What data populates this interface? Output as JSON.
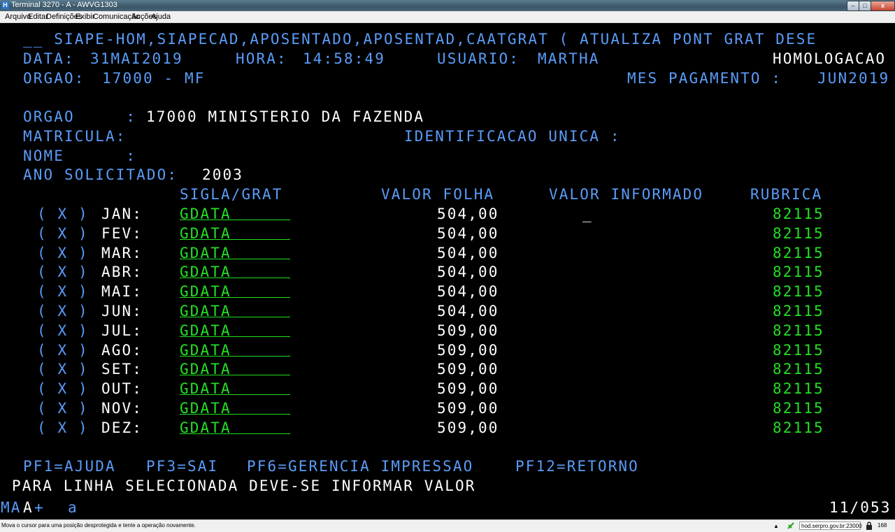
{
  "window": {
    "title": "Terminal 3270 - A - AWVG1303",
    "close": "x",
    "min": "–",
    "max": "□",
    "app_icon": "H"
  },
  "menu": [
    "Arquivo",
    "Editar",
    "Definições",
    "Exibir",
    "Comunicação",
    "Acções",
    "Ajuda"
  ],
  "header": {
    "line1": "__ SIAPE-HOM,SIAPECAD,APOSENTADO,APOSENTAD,CAATGRAT ( ATUALIZA PONT GRAT DESE",
    "data_label": "DATA:",
    "data_value": "31MAI2019",
    "hora_label": "HORA:",
    "hora_value": "14:58:49",
    "usuario_label": "USUARIO:",
    "usuario_value": "MARTHA",
    "env": "HOMOLOGACAO",
    "orgao_label": "ORGAO:",
    "orgao_value": "17000 - MF",
    "mes_label": "MES PAGAMENTO :",
    "mes_value": "JUN2019"
  },
  "form": {
    "orgao_label": "ORGAO     :",
    "orgao_value": "17000 MINISTERIO DA FAZENDA",
    "matricula_label": "MATRICULA:",
    "ident_label": "IDENTIFICACAO UNICA :",
    "nome_label": "NOME      :",
    "ano_label": "ANO SOLICITADO:",
    "ano_value": "2003"
  },
  "table": {
    "headers": {
      "sigla": "SIGLA/GRAT",
      "valor_folha": "VALOR FOLHA",
      "valor_informado": "VALOR INFORMADO",
      "rubrica": "RUBRICA"
    },
    "rows": [
      {
        "sel": "( X )",
        "mes": "JAN:",
        "sigla": "GDATA",
        "valor": "504,00",
        "informado": "_",
        "rubrica": "82115"
      },
      {
        "sel": "( X )",
        "mes": "FEV:",
        "sigla": "GDATA",
        "valor": "504,00",
        "informado": "",
        "rubrica": "82115"
      },
      {
        "sel": "( X )",
        "mes": "MAR:",
        "sigla": "GDATA",
        "valor": "504,00",
        "informado": "",
        "rubrica": "82115"
      },
      {
        "sel": "( X )",
        "mes": "ABR:",
        "sigla": "GDATA",
        "valor": "504,00",
        "informado": "",
        "rubrica": "82115"
      },
      {
        "sel": "( X )",
        "mes": "MAI:",
        "sigla": "GDATA",
        "valor": "504,00",
        "informado": "",
        "rubrica": "82115"
      },
      {
        "sel": "( X )",
        "mes": "JUN:",
        "sigla": "GDATA",
        "valor": "504,00",
        "informado": "",
        "rubrica": "82115"
      },
      {
        "sel": "( X )",
        "mes": "JUL:",
        "sigla": "GDATA",
        "valor": "509,00",
        "informado": "",
        "rubrica": "82115"
      },
      {
        "sel": "( X )",
        "mes": "AGO:",
        "sigla": "GDATA",
        "valor": "509,00",
        "informado": "",
        "rubrica": "82115"
      },
      {
        "sel": "( X )",
        "mes": "SET:",
        "sigla": "GDATA",
        "valor": "509,00",
        "informado": "",
        "rubrica": "82115"
      },
      {
        "sel": "( X )",
        "mes": "OUT:",
        "sigla": "GDATA",
        "valor": "509,00",
        "informado": "",
        "rubrica": "82115"
      },
      {
        "sel": "( X )",
        "mes": "NOV:",
        "sigla": "GDATA",
        "valor": "509,00",
        "informado": "",
        "rubrica": "82115"
      },
      {
        "sel": "( X )",
        "mes": "DEZ:",
        "sigla": "GDATA",
        "valor": "509,00",
        "informado": "",
        "rubrica": "82115"
      }
    ]
  },
  "footer": {
    "pf1": "PF1=AJUDA",
    "pf3": "PF3=SAI",
    "pf6": "PF6=GERENCIA IMPRESSAO",
    "pf12": "PF12=RETORNO",
    "message": "PARA LINHA SELECIONADA DEVE-SE INFORMAR VALOR"
  },
  "oia": {
    "mode": "MA",
    "cursor_char": "A",
    "plus": "+",
    "input_char": "a",
    "position": "11/053"
  },
  "status": {
    "message": "Mova o cursor para uma posição desprotegida e tente a operação novamente.",
    "host": "hod.serpro.gov.br:23000",
    "number": "168"
  },
  "icons": [
    "app-icon",
    "minimize-icon",
    "maximize-icon",
    "close-icon",
    "connection-icon",
    "lock-icon",
    "scroll-up-icon"
  ],
  "colors": {
    "field_label": "#5a9cf8",
    "value": "#ffffff",
    "protected_green": "#22e022",
    "cursor": "#3f6ff0"
  }
}
